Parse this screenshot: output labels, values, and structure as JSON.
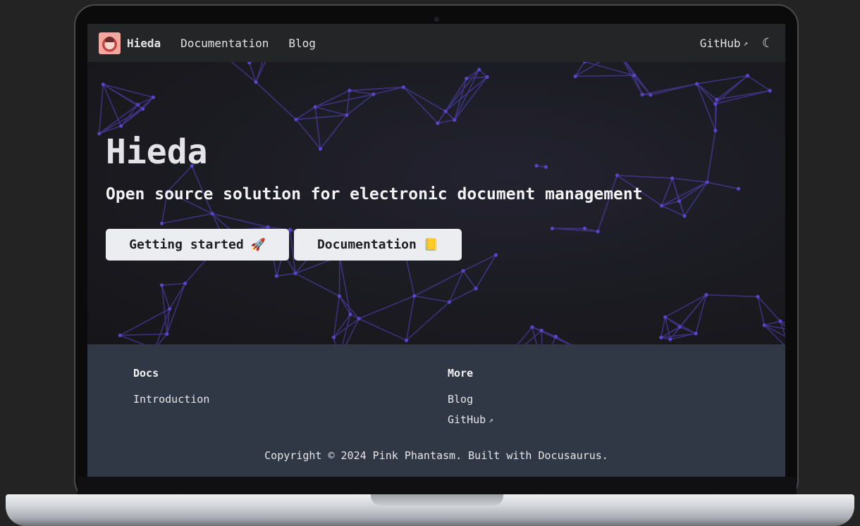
{
  "navbar": {
    "brand": "Hieda",
    "links": [
      "Documentation",
      "Blog"
    ],
    "github": "GitHub",
    "theme_icon": "moon-icon"
  },
  "hero": {
    "title": "Hieda",
    "subtitle": "Open source solution for electronic document management",
    "buttons": [
      {
        "label": "Getting started",
        "emoji": "🚀"
      },
      {
        "label": "Documentation",
        "emoji": "📒"
      }
    ],
    "accent": "#5a45c9"
  },
  "footer": {
    "columns": [
      {
        "title": "Docs",
        "links": [
          "Introduction"
        ]
      },
      {
        "title": "More",
        "links": [
          "Blog",
          "GitHub"
        ]
      }
    ],
    "copyright": "Copyright © 2024 Pink Phantasm. Built with Docusaurus."
  },
  "colors": {
    "navbar_bg": "#242526",
    "footer_bg": "#303846",
    "button_bg": "#ebedf0"
  }
}
